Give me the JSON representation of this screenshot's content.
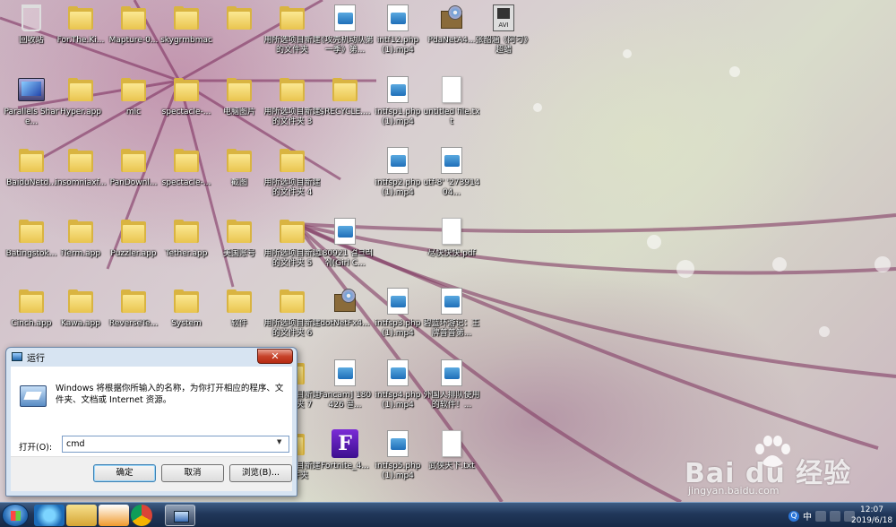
{
  "desktop": {
    "icons": [
      {
        "label": "回收站",
        "type": "recycle",
        "icon": "recycle-bin-icon"
      },
      {
        "label": "For.The.Ki...",
        "type": "folder",
        "icon": "folder-icon"
      },
      {
        "label": "Mapture-0...",
        "type": "folder",
        "icon": "folder-icon"
      },
      {
        "label": "skygrmbmac",
        "type": "folder",
        "icon": "folder-icon"
      },
      {
        "label": "",
        "type": "folder",
        "icon": "folder-icon"
      },
      {
        "label": "用所选项目新建的文件夹",
        "type": "folder",
        "icon": "folder-icon"
      },
      {
        "label": "《攻壳机动队第一季》第...",
        "type": "media",
        "icon": "media-file-icon"
      },
      {
        "label": "intf12.php (1).mp4",
        "type": "media",
        "icon": "media-file-icon"
      },
      {
        "label": "PdaNetA4...",
        "type": "installer",
        "icon": "installer-icon"
      },
      {
        "label": "张韶涵《阿刁》超蜡",
        "type": "video",
        "icon": "avi-file-icon"
      },
      {
        "label": "Parallels Share...",
        "type": "parallels",
        "icon": "parallels-share-icon"
      },
      {
        "label": "Hyper.app",
        "type": "folder",
        "icon": "folder-icon"
      },
      {
        "label": "mic",
        "type": "folder",
        "icon": "folder-icon"
      },
      {
        "label": "spectacle-...",
        "type": "folder",
        "icon": "folder-icon"
      },
      {
        "label": "电脑图片",
        "type": "folder",
        "icon": "folder-icon"
      },
      {
        "label": "用所选项目新建的文件夹 3",
        "type": "folder",
        "icon": "folder-icon"
      },
      {
        "label": "$RECYCLE....",
        "type": "folder",
        "icon": "folder-icon"
      },
      {
        "label": "intfsp1.php (1).mp4",
        "type": "media",
        "icon": "media-file-icon"
      },
      {
        "label": "untitled file.txt",
        "type": "doc",
        "icon": "text-file-icon"
      },
      {
        "label": "BaiduNetd...",
        "type": "folder",
        "icon": "folder-icon"
      },
      {
        "label": "insomniaxf...",
        "type": "folder",
        "icon": "folder-icon"
      },
      {
        "label": "PanDownl...",
        "type": "folder",
        "icon": "folder-icon"
      },
      {
        "label": "spectacle-...",
        "type": "folder",
        "icon": "folder-icon"
      },
      {
        "label": "截图",
        "type": "folder",
        "icon": "folder-icon"
      },
      {
        "label": "用所选项目新建的文件夹 4",
        "type": "folder",
        "icon": "folder-icon"
      },
      {
        "label": "intfsp2.php (1).mp4",
        "type": "media",
        "icon": "media-file-icon"
      },
      {
        "label": "utf-8' '27391404...",
        "type": "media",
        "icon": "media-file-icon"
      },
      {
        "label": "Batingstok...",
        "type": "folder",
        "icon": "folder-icon"
      },
      {
        "label": "iTerm.app",
        "type": "folder",
        "icon": "folder-icon"
      },
      {
        "label": "Puzzler.app",
        "type": "folder",
        "icon": "folder-icon"
      },
      {
        "label": "Tether.app",
        "type": "folder",
        "icon": "folder-icon"
      },
      {
        "label": "美国账号",
        "type": "folder",
        "icon": "folder-icon"
      },
      {
        "label": "用所选项目新建的文件夹 5",
        "type": "folder",
        "icon": "folder-icon"
      },
      {
        "label": "180921 걸크러쉬(Girl C...",
        "type": "media",
        "icon": "media-file-icon"
      },
      {
        "label": "尽快快快.pdf",
        "type": "doc",
        "icon": "pdf-file-icon"
      },
      {
        "label": "Cinch.app",
        "type": "folder",
        "icon": "folder-icon"
      },
      {
        "label": "Kawa.app",
        "type": "folder",
        "icon": "folder-icon"
      },
      {
        "label": "ReverseTe...",
        "type": "folder",
        "icon": "folder-icon"
      },
      {
        "label": "System",
        "type": "folder",
        "icon": "folder-icon"
      },
      {
        "label": "软件",
        "type": "folder",
        "icon": "folder-icon"
      },
      {
        "label": "用所选项目新建的文件夹 6",
        "type": "folder",
        "icon": "folder-icon"
      },
      {
        "label": "dotNetFx4...",
        "type": "installer",
        "icon": "installer-icon"
      },
      {
        "label": "intfsp3.php (1).mp4",
        "type": "media",
        "icon": "media-file-icon"
      },
      {
        "label": "碧蓝环游记：王牌普普第...",
        "type": "media",
        "icon": "media-file-icon"
      },
      {
        "label": "用所选项目新建的文件夹 7",
        "type": "folder",
        "icon": "folder-icon"
      },
      {
        "label": "Fancam] 180426 골...",
        "type": "media",
        "icon": "media-file-icon"
      },
      {
        "label": "intfsp4.php (1).mp4",
        "type": "media",
        "icon": "media-file-icon"
      },
      {
        "label": "外国人排队使用的软件！...",
        "type": "media",
        "icon": "media-file-icon"
      },
      {
        "label": "用所选项目新建的文件夹",
        "type": "folder",
        "icon": "folder-icon"
      },
      {
        "label": "Fortnite_4...",
        "type": "fortnite",
        "icon": "fortnite-icon"
      },
      {
        "label": "intfsp5.php (1).mp4",
        "type": "media",
        "icon": "media-file-icon"
      },
      {
        "label": "武侠天下.txt",
        "type": "doc",
        "icon": "text-file-icon"
      }
    ]
  },
  "run_dialog": {
    "title": "运行",
    "close": "✕",
    "description": "Windows 将根据你所输入的名称，为你打开相应的程序、文件夹、文档或 Internet 资源。",
    "open_label": "打开(O):",
    "input_value": "cmd",
    "ok": "确定",
    "cancel": "取消",
    "browse": "浏览(B)..."
  },
  "taskbar": {
    "apps": [
      "start-orb-icon",
      "internet-explorer-icon",
      "file-explorer-icon",
      "media-player-icon",
      "chrome-icon",
      "run-icon"
    ],
    "tray_q": "Q",
    "ime": "中",
    "time": "12:07",
    "date": "2019/6/18"
  },
  "watermark": {
    "logo": "Bai du 经验",
    "url": "jingyan.baidu.com"
  },
  "colors": {
    "taskbar": "#21375a",
    "arrow": "#f28a1e",
    "folder": "#e9c44e",
    "close_button": "#c7432b"
  }
}
